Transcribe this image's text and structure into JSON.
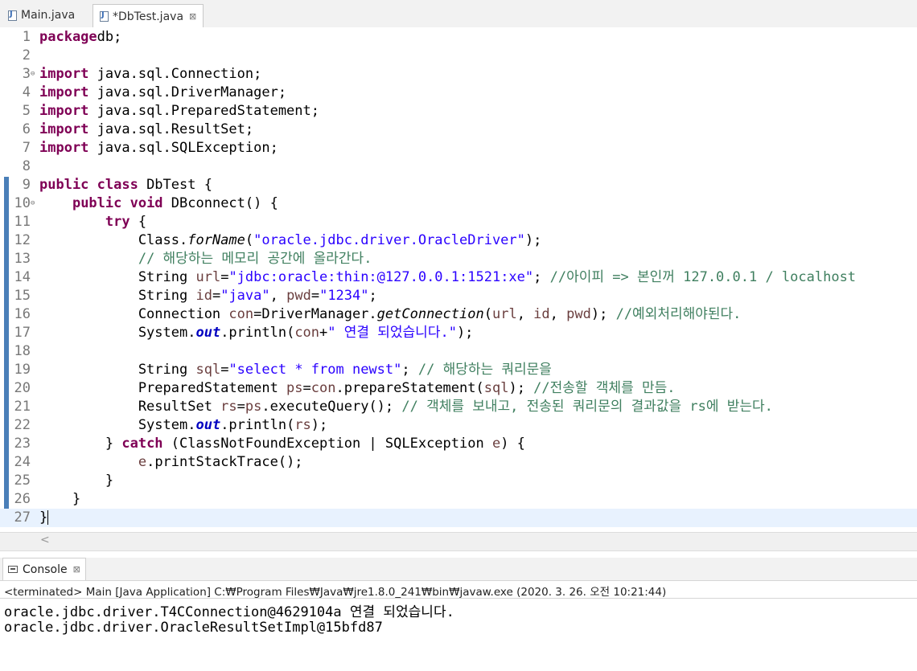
{
  "editor_tabs": [
    {
      "label": "Main.java",
      "active": false
    },
    {
      "label": "*DbTest.java",
      "active": true,
      "close": "⊠"
    }
  ],
  "code_lines": [
    {
      "n": "1",
      "tokens": [
        [
          "kw",
          "package"
        ],
        [
          "",
          "db;"
        ]
      ]
    },
    {
      "n": "2",
      "tokens": []
    },
    {
      "n": "3",
      "fold": "⊖",
      "tokens": [
        [
          "kw",
          "import"
        ],
        [
          "",
          " java.sql.Connection;"
        ]
      ]
    },
    {
      "n": "4",
      "tokens": [
        [
          "kw",
          "import"
        ],
        [
          "",
          " java.sql.DriverManager;"
        ]
      ]
    },
    {
      "n": "5",
      "tokens": [
        [
          "kw",
          "import"
        ],
        [
          "",
          " java.sql.PreparedStatement;"
        ]
      ]
    },
    {
      "n": "6",
      "tokens": [
        [
          "kw",
          "import"
        ],
        [
          "",
          " java.sql.ResultSet;"
        ]
      ]
    },
    {
      "n": "7",
      "tokens": [
        [
          "kw",
          "import"
        ],
        [
          "",
          " java.sql.SQLException;"
        ]
      ]
    },
    {
      "n": "8",
      "tokens": []
    },
    {
      "n": "9",
      "tokens": [
        [
          "kw",
          "public class"
        ],
        [
          "",
          " DbTest {"
        ]
      ]
    },
    {
      "n": "10",
      "fold": "⊖",
      "tokens": [
        [
          "",
          "    "
        ],
        [
          "kw",
          "public void"
        ],
        [
          "",
          " DBconnect() {"
        ]
      ]
    },
    {
      "n": "11",
      "tokens": [
        [
          "",
          "        "
        ],
        [
          "kw",
          "try"
        ],
        [
          "",
          " {"
        ]
      ]
    },
    {
      "n": "12",
      "tokens": [
        [
          "",
          "            Class."
        ],
        [
          "it",
          "forName"
        ],
        [
          "",
          "("
        ],
        [
          "str",
          "\"oracle.jdbc.driver.OracleDriver\""
        ],
        [
          "",
          ");"
        ]
      ]
    },
    {
      "n": "13",
      "tokens": [
        [
          "",
          "            "
        ],
        [
          "cm",
          "// 해당하는 메모리 공간에 올라간다."
        ]
      ]
    },
    {
      "n": "14",
      "tokens": [
        [
          "",
          "            String "
        ],
        [
          "var",
          "url"
        ],
        [
          "",
          "="
        ],
        [
          "str",
          "\"jdbc:oracle:thin:@127.0.0.1:1521:xe\""
        ],
        [
          "",
          "; "
        ],
        [
          "cm",
          "//아이피 => 본인꺼 127.0.0.1 / localhost"
        ]
      ]
    },
    {
      "n": "15",
      "tokens": [
        [
          "",
          "            String "
        ],
        [
          "var",
          "id"
        ],
        [
          "",
          "="
        ],
        [
          "str",
          "\"java\""
        ],
        [
          "",
          ", "
        ],
        [
          "var",
          "pwd"
        ],
        [
          "",
          "="
        ],
        [
          "str",
          "\"1234\""
        ],
        [
          "",
          ";"
        ]
      ]
    },
    {
      "n": "16",
      "tokens": [
        [
          "",
          "            Connection "
        ],
        [
          "var",
          "con"
        ],
        [
          "",
          "=DriverManager."
        ],
        [
          "it",
          "getConnection"
        ],
        [
          "",
          "("
        ],
        [
          "var",
          "url"
        ],
        [
          "",
          ", "
        ],
        [
          "var",
          "id"
        ],
        [
          "",
          ", "
        ],
        [
          "var",
          "pwd"
        ],
        [
          "",
          "); "
        ],
        [
          "cm",
          "//예외처리해야된다."
        ]
      ]
    },
    {
      "n": "17",
      "tokens": [
        [
          "",
          "            System."
        ],
        [
          "fld",
          "out"
        ],
        [
          "",
          ".println("
        ],
        [
          "var",
          "con"
        ],
        [
          "",
          "+"
        ],
        [
          "str",
          "\" 연결 되었습니다.\""
        ],
        [
          "",
          ");"
        ]
      ]
    },
    {
      "n": "18",
      "tokens": []
    },
    {
      "n": "19",
      "tokens": [
        [
          "",
          "            String "
        ],
        [
          "var",
          "sql"
        ],
        [
          "",
          "="
        ],
        [
          "str",
          "\"select * from newst\""
        ],
        [
          "",
          "; "
        ],
        [
          "cm",
          "// 해당하는 쿼리문을"
        ]
      ]
    },
    {
      "n": "20",
      "tokens": [
        [
          "",
          "            PreparedStatement "
        ],
        [
          "var",
          "ps"
        ],
        [
          "",
          "="
        ],
        [
          "var",
          "con"
        ],
        [
          "",
          ".prepareStatement("
        ],
        [
          "var",
          "sql"
        ],
        [
          "",
          "); "
        ],
        [
          "cm",
          "//전송할 객체를 만듬."
        ]
      ]
    },
    {
      "n": "21",
      "tokens": [
        [
          "",
          "            ResultSet "
        ],
        [
          "var",
          "rs"
        ],
        [
          "",
          "="
        ],
        [
          "var",
          "ps"
        ],
        [
          "",
          ".executeQuery(); "
        ],
        [
          "cm",
          "// 객체를 보내고, 전송된 쿼리문의 결과값을 rs에 받는다."
        ]
      ]
    },
    {
      "n": "22",
      "tokens": [
        [
          "",
          "            System."
        ],
        [
          "fld",
          "out"
        ],
        [
          "",
          ".println("
        ],
        [
          "var",
          "rs"
        ],
        [
          "",
          ");"
        ]
      ]
    },
    {
      "n": "23",
      "tokens": [
        [
          "",
          "        } "
        ],
        [
          "kw",
          "catch"
        ],
        [
          "",
          " (ClassNotFoundException | SQLException "
        ],
        [
          "var",
          "e"
        ],
        [
          "",
          ") {"
        ]
      ]
    },
    {
      "n": "24",
      "tokens": [
        [
          "",
          "            "
        ],
        [
          "var",
          "e"
        ],
        [
          "",
          ".printStackTrace();"
        ]
      ]
    },
    {
      "n": "25",
      "tokens": [
        [
          "",
          "        }"
        ]
      ]
    },
    {
      "n": "26",
      "tokens": [
        [
          "",
          "    }"
        ]
      ]
    },
    {
      "n": "27",
      "current": true,
      "tokens": [
        [
          "",
          "}"
        ],
        [
          "caret",
          ""
        ]
      ]
    }
  ],
  "console": {
    "tab_label": "Console",
    "tab_close": "⊠",
    "status": "<terminated> Main [Java Application] C:₩Program Files₩Java₩jre1.8.0_241₩bin₩javaw.exe (2020. 3. 26. 오전 10:21:44)",
    "output": [
      "oracle.jdbc.driver.T4CConnection@4629104a 연결 되었습니다.",
      "oracle.jdbc.driver.OracleResultSetImpl@15bfd87"
    ]
  },
  "scroll_arrow": "<"
}
